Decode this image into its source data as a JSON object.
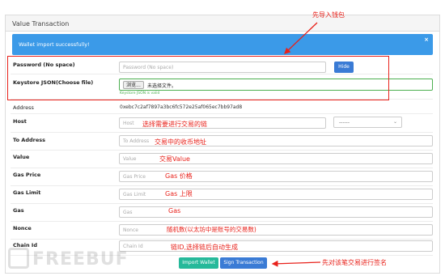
{
  "panel": {
    "title": "Value Transaction"
  },
  "alert": {
    "message": "Wallet import successfully!",
    "close": "×"
  },
  "fields": {
    "password": {
      "label": "Password (No space)",
      "placeholder": "Password (No space)"
    },
    "hide_button": "Hide",
    "keystore": {
      "label": "Keystore JSON(Choose file)",
      "browse": "浏览...",
      "file_text": "未选择文件。",
      "valid_text": "Keystore JSON is valid"
    },
    "address": {
      "label": "Address",
      "value": "0xebc7c2af7897a3bc6fc572e25af065ec7bb97ad8"
    },
    "host": {
      "label": "Host",
      "placeholder": "Host",
      "select_value": "------"
    },
    "to_address": {
      "label": "To Address",
      "placeholder": "To Address"
    },
    "value": {
      "label": "Value",
      "placeholder": "Value"
    },
    "gas_price": {
      "label": "Gas Price",
      "placeholder": "Gas Price"
    },
    "gas_limit": {
      "label": "Gas Limit",
      "placeholder": "Gas Limit"
    },
    "gas": {
      "label": "Gas",
      "placeholder": "Gas"
    },
    "nonce": {
      "label": "Nonce",
      "placeholder": "Nonce"
    },
    "chain_id": {
      "label": "Chain Id",
      "placeholder": "Chain Id"
    }
  },
  "buttons": {
    "import_wallet": "Import Wallet",
    "sign_transaction": "Sign Transaction"
  },
  "annotations": {
    "import_wallet_first": "先导入钱包",
    "host": "选择需要进行交易的链",
    "to_address": "交易中的收币地址",
    "value": "交易Value",
    "gas_price": "Gas 价格",
    "gas_limit": "Gas 上限",
    "gas": "Gas",
    "nonce": "随机数(以太坊中是账号的交易数)",
    "chain_id": "链ID,选择链后自动生成",
    "sign": "先对该笔交易进行签名"
  },
  "watermark": "FREEBUF",
  "colors": {
    "accent": "#3a7bd5",
    "alert": "#3b9ae8",
    "success": "#26b99a",
    "annotation": "#e8221b"
  }
}
